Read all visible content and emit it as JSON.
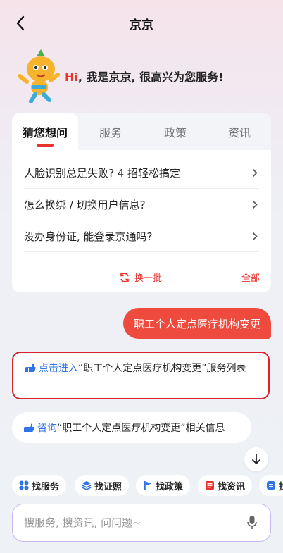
{
  "header": {
    "title": "京京"
  },
  "greeting": {
    "hi": "Hi",
    "message": ", 我是京京, 很高兴为您服务!"
  },
  "tabs": [
    {
      "label": "猜您想问",
      "active": true
    },
    {
      "label": "服务",
      "active": false
    },
    {
      "label": "政策",
      "active": false
    },
    {
      "label": "资讯",
      "active": false
    }
  ],
  "questions": [
    "人脸识别总是失败? 4 招轻松搞定",
    "怎么换绑 / 切换用户信息?",
    "没办身份证, 能登录京通吗?"
  ],
  "refresh_label": "换一批",
  "all_label": "全部",
  "user_message": "职工个人定点医疗机构变更",
  "response1": {
    "link": "点击进入",
    "text": "“职工个人定点医疗机构变更”服务列表"
  },
  "response2": {
    "link": "咨询",
    "text": "“职工个人定点医疗机构变更”相关信息"
  },
  "chips": [
    {
      "label": "找服务",
      "icon": "grid-icon"
    },
    {
      "label": "找证照",
      "icon": "layers-icon"
    },
    {
      "label": "找政策",
      "icon": "flag-icon"
    },
    {
      "label": "找资讯",
      "icon": "news-icon"
    },
    {
      "label": "找",
      "icon": "doc-icon"
    }
  ],
  "search": {
    "placeholder": "搜服务, 搜资讯, 问问题~"
  },
  "colors": {
    "accent": "#e8322c",
    "link": "#2f73e8",
    "bubble": "#ee4a3d",
    "highlight_border": "#d9232d"
  }
}
